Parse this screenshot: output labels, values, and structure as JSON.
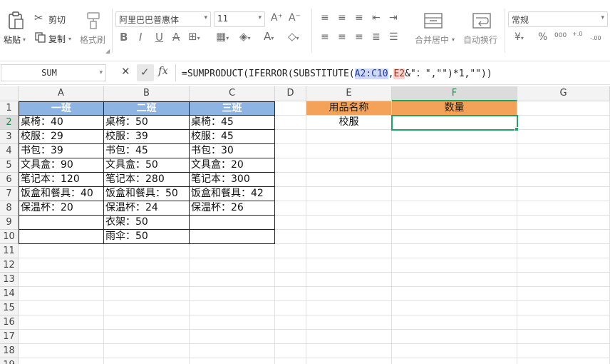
{
  "toolbar": {
    "paste_label": "粘贴",
    "cut_label": "剪切",
    "copy_label": "复制",
    "format_painter_label": "格式刷",
    "font_name": "阿里巴巴普惠体",
    "font_size": "11",
    "bold": "B",
    "italic": "I",
    "underline": "U",
    "strike": "A",
    "increase_font": "A⁺",
    "decrease_font": "A⁻",
    "merge_label": "合并居中",
    "wrap_label": "自动换行",
    "number_format": "常规",
    "currency_symbol": "¥",
    "percent_symbol": "%",
    "thousands_symbol": "000",
    "increase_decimal": "+.0",
    "decrease_decimal": "-.00"
  },
  "formula_bar": {
    "name_box": "SUM",
    "fx_label": "fx",
    "formula_prefix": "=SUMPRODUCT(IFERROR(SUBSTITUTE(",
    "formula_ref1": "A2:C10",
    "formula_sep": ",",
    "formula_ref2": "E2",
    "formula_suffix": "&\"：\",\"\")*1,\"\"))"
  },
  "grid": {
    "columns": [
      "A",
      "B",
      "C",
      "D",
      "E",
      "F",
      "G"
    ],
    "active_column": "F",
    "rows": [
      "1",
      "2",
      "3",
      "4",
      "5",
      "6",
      "7",
      "8",
      "9",
      "10",
      "11",
      "12",
      "13",
      "14",
      "15",
      "16",
      "17",
      "18",
      "19"
    ],
    "active_row": "2",
    "headers": {
      "a1": "一班",
      "b1": "二班",
      "c1": "三班",
      "e1": "用品名称",
      "f1": "数量"
    },
    "col_a": [
      "桌椅：40",
      "校服：29",
      "书包：39",
      "文具盒：90",
      "笔记本：120",
      "饭盒和餐具：40",
      "保温杯：20",
      "",
      ""
    ],
    "col_b": [
      "桌椅：50",
      "校服：39",
      "书包：45",
      "文具盒：50",
      "笔记本：280",
      "饭盒和餐具：50",
      "保温杯：24",
      "衣架：50",
      "雨伞：50"
    ],
    "col_c": [
      "桌椅：45",
      "校服：45",
      "书包：30",
      "文具盒：20",
      "笔记本：300",
      "饭盒和餐具：42",
      "保温杯：26",
      "",
      ""
    ],
    "e2": "校服",
    "f2": ""
  },
  "colors": {
    "class_header_bg": "#8eb4e3",
    "lookup_header_bg": "#f4a259",
    "selection": "#21a366"
  }
}
